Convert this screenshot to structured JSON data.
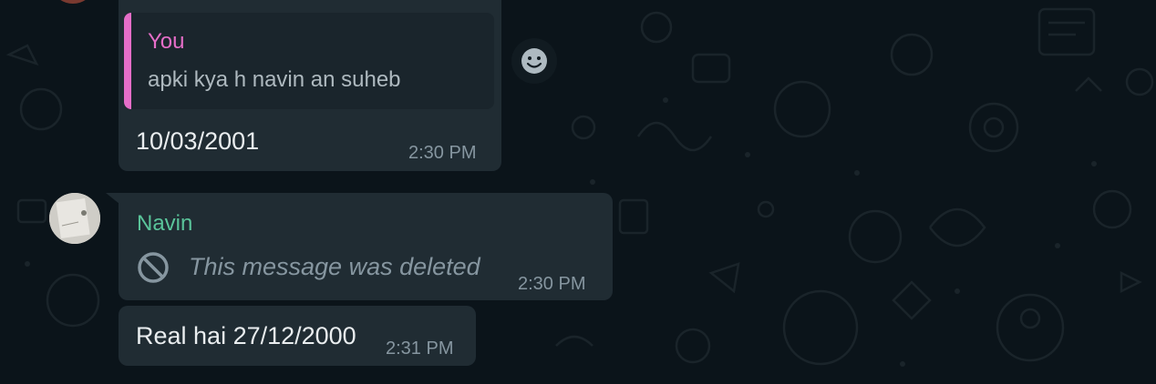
{
  "colors": {
    "background": "#0b141a",
    "bubble": "#202c33",
    "you_accent": "#e56ec8",
    "navin_accent": "#5ac49a",
    "meta_text": "#8696a0"
  },
  "messages": [
    {
      "quote": {
        "author": "You",
        "text": "apki kya h navin an suheb"
      },
      "text": "10/03/2001",
      "time": "2:30 PM"
    },
    {
      "sender": "Navin",
      "deleted_text": "This message was deleted",
      "time": "2:30 PM",
      "icon": "ban-icon"
    },
    {
      "text": "Real hai 27/12/2000",
      "time": "2:31 PM"
    }
  ],
  "reaction_icon": "smiley-icon"
}
